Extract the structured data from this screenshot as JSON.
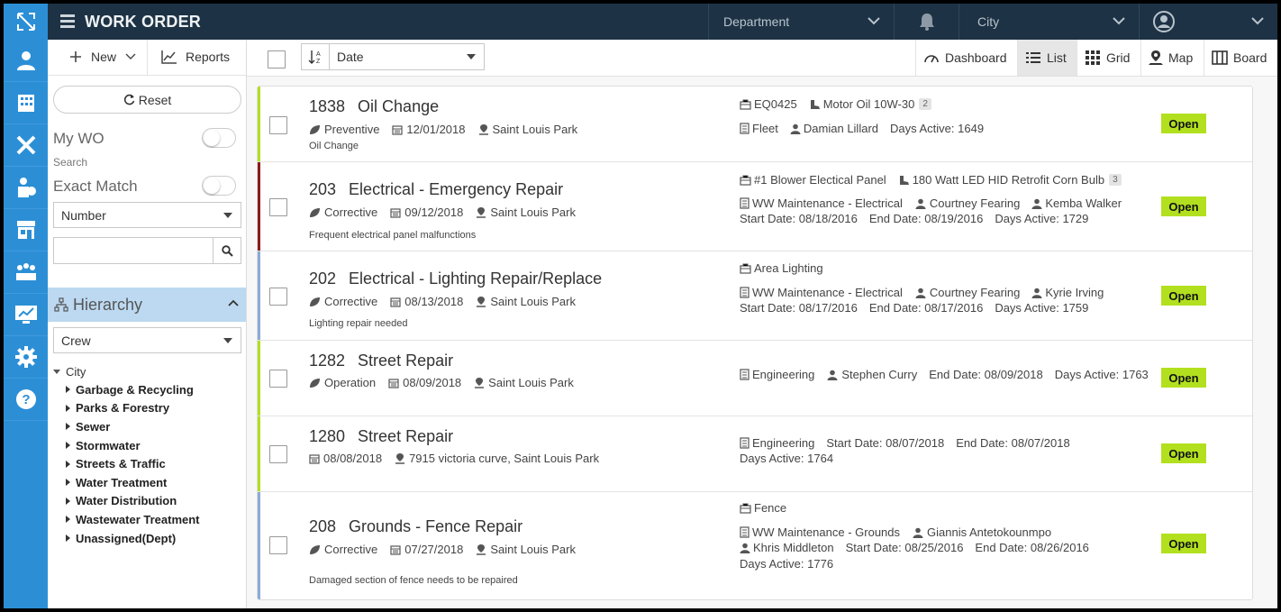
{
  "header": {
    "title": "WORK ORDER",
    "department_label": "Department",
    "city_label": "City"
  },
  "left_toolbar": {
    "new_label": "New",
    "reports_label": "Reports"
  },
  "filters": {
    "reset_label": "Reset",
    "my_wo_label": "My WO",
    "search_caption": "Search",
    "exact_match_label": "Exact Match",
    "field_select_value": "Number",
    "search_value": "",
    "hierarchy_label": "Hierarchy",
    "hierarchy_select_value": "Crew"
  },
  "tree": {
    "root": "City",
    "children": [
      "Garbage & Recycling",
      "Parks & Forestry",
      "Sewer",
      "Stormwater",
      "Streets & Traffic",
      "Water Treatment",
      "Water Distribution",
      "Wastewater Treatment",
      "Unassigned(Dept)"
    ]
  },
  "main_toolbar": {
    "sort_field": "Date",
    "views": [
      "Dashboard",
      "List",
      "Grid",
      "Map",
      "Board"
    ],
    "active_view": "List"
  },
  "colors": {
    "topbar": "#1d3244",
    "rail": "#2c8fd6",
    "status_open": "#b2e01f",
    "preventive_bar": "#b2e01f",
    "emergency_bar": "#8b1a1a",
    "corrective_bar": "#8aaad6"
  },
  "work_orders": [
    {
      "number": "1838",
      "title": "Oil Change",
      "type": "Preventive",
      "date": "12/01/2018",
      "location": "Saint Louis Park",
      "description": "Oil Change",
      "asset": "EQ0425",
      "part": "Motor Oil 10W-30",
      "part_count": "2",
      "department": "Fleet",
      "assignee1": "Damian Lillard",
      "assignee2": "",
      "start_date": "",
      "end_date": "",
      "days_active": "Days Active: 1649",
      "status": "Open"
    },
    {
      "number": "203",
      "title": "Electrical - Emergency Repair",
      "type": "Corrective",
      "date": "09/12/2018",
      "location": "Saint Louis Park",
      "description": "Frequent electrical panel malfunctions",
      "asset": "#1 Blower Electical Panel",
      "part": "180 Watt LED HID Retrofit Corn Bulb",
      "part_count": "3",
      "department": "WW Maintenance - Electrical",
      "assignee1": "Courtney Fearing",
      "assignee2": "Kemba Walker",
      "start_date": "Start Date: 08/18/2016",
      "end_date": "End Date: 08/19/2016",
      "days_active": "Days Active: 1729",
      "status": "Open"
    },
    {
      "number": "202",
      "title": "Electrical - Lighting Repair/Replace",
      "type": "Corrective",
      "date": "08/13/2018",
      "location": "Saint Louis Park",
      "description": "Lighting repair needed",
      "asset": "Area Lighting",
      "part": "",
      "part_count": "",
      "department": "WW Maintenance - Electrical",
      "assignee1": "Courtney Fearing",
      "assignee2": "Kyrie Irving",
      "start_date": "Start Date: 08/17/2016",
      "end_date": "End Date: 08/17/2016",
      "days_active": "Days Active: 1759",
      "status": "Open"
    },
    {
      "number": "1282",
      "title": "Street Repair",
      "type": "Operation",
      "date": "08/09/2018",
      "location": "Saint Louis Park",
      "description": "",
      "asset": "",
      "part": "",
      "part_count": "",
      "department": "Engineering",
      "assignee1": "Stephen Curry",
      "assignee2": "",
      "start_date": "",
      "end_date": "End Date: 08/09/2018",
      "days_active": "Days Active: 1763",
      "status": "Open"
    },
    {
      "number": "1280",
      "title": "Street Repair",
      "type": "",
      "date": "08/08/2018",
      "location": "7915 victoria curve, Saint Louis Park",
      "description": "",
      "asset": "",
      "part": "",
      "part_count": "",
      "department": "Engineering",
      "assignee1": "",
      "assignee2": "",
      "start_date": "Start Date: 08/07/2018",
      "end_date": "End Date: 08/07/2018",
      "days_active": "Days Active: 1764",
      "status": "Open"
    },
    {
      "number": "208",
      "title": "Grounds - Fence Repair",
      "type": "Corrective",
      "date": "07/27/2018",
      "location": "Saint Louis Park",
      "description": "Damaged section of fence needs to be repaired",
      "asset": "Fence",
      "part": "",
      "part_count": "",
      "department": "WW Maintenance - Grounds",
      "assignee1": "Giannis Antetokounmpo",
      "assignee2": "Khris Middleton",
      "start_date": "Start Date: 08/25/2016",
      "end_date": "End Date: 08/26/2016",
      "days_active": "Days Active: 1776",
      "status": "Open"
    }
  ]
}
